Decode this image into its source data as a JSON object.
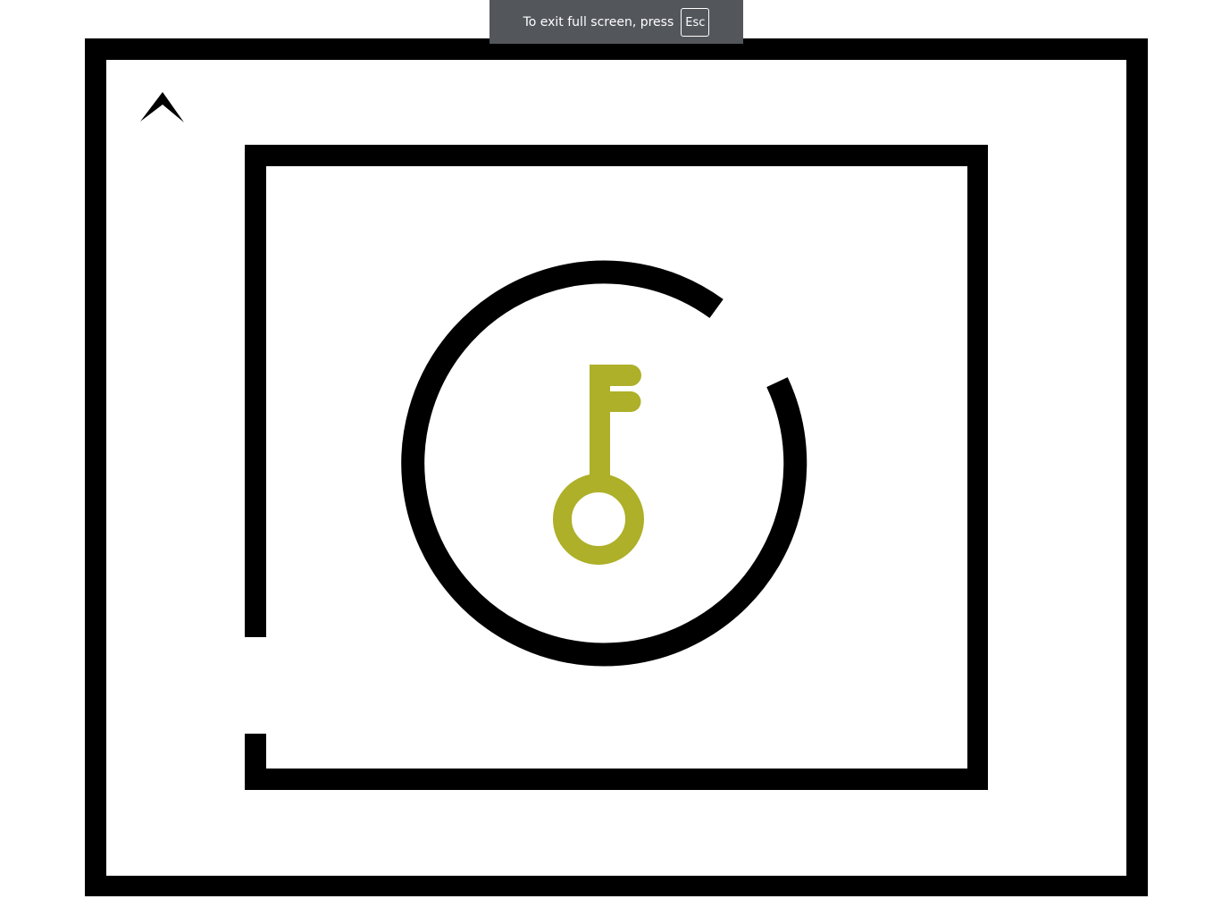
{
  "fullscreen_notice": {
    "message": "To exit full screen, press",
    "key": "Esc"
  },
  "game": {
    "wall_color": "#000000",
    "background_color": "#ffffff",
    "key_color": "#adb028",
    "player_icon": "chevron-up-icon",
    "key_icon": "key-icon"
  }
}
